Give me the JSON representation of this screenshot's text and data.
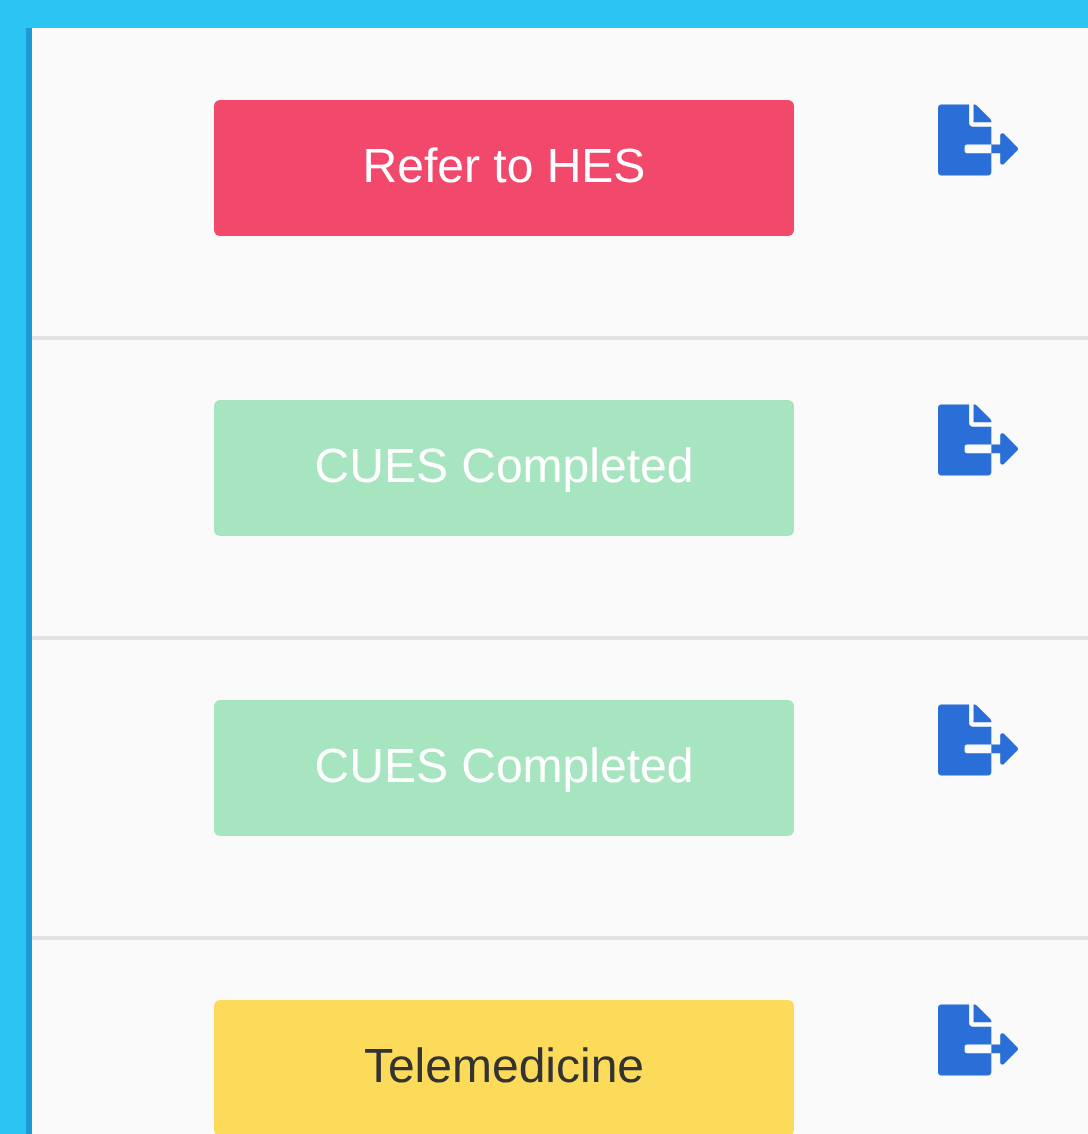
{
  "rows": [
    {
      "status": {
        "label": "Refer to HES",
        "kind": "danger"
      }
    },
    {
      "status": {
        "label": "CUES Completed",
        "kind": "success"
      }
    },
    {
      "status": {
        "label": "CUES Completed",
        "kind": "success"
      }
    },
    {
      "status": {
        "label": "Telemedicine",
        "kind": "warning"
      }
    }
  ]
}
